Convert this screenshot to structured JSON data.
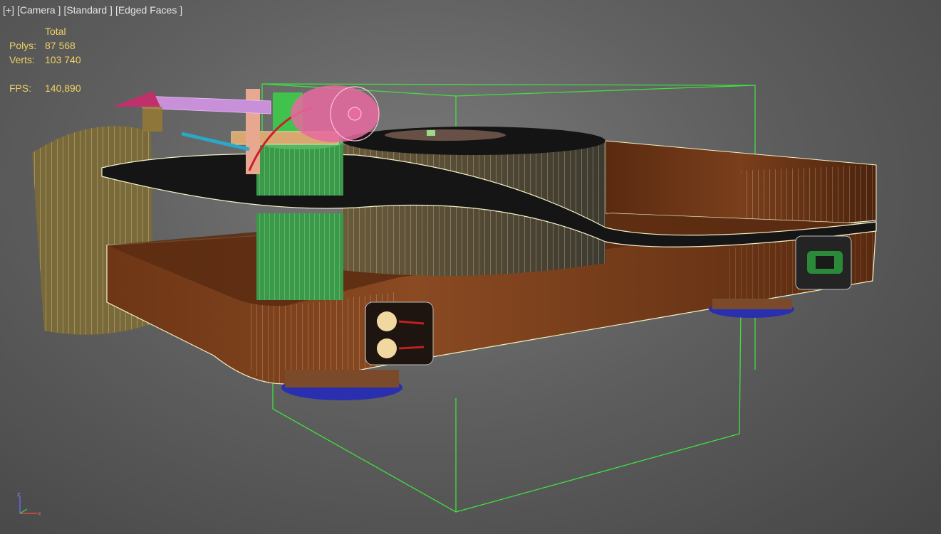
{
  "viewport": {
    "labels": [
      "[+]",
      "[Camera ]",
      "[Standard ]",
      "[Edged Faces ]"
    ]
  },
  "stats": {
    "header": "Total",
    "polys_label": "Polys:",
    "polys_value": "87 568",
    "verts_label": "Verts:",
    "verts_value": "103 740",
    "fps_label": "FPS:",
    "fps_value": "140,890"
  },
  "gizmo": {
    "z": "z",
    "x": "x"
  },
  "colors": {
    "selection_box": "#3fe03f",
    "wood": "#6b3416",
    "wireframe": "#f2f2c8",
    "feet": "#2a2fb0"
  }
}
